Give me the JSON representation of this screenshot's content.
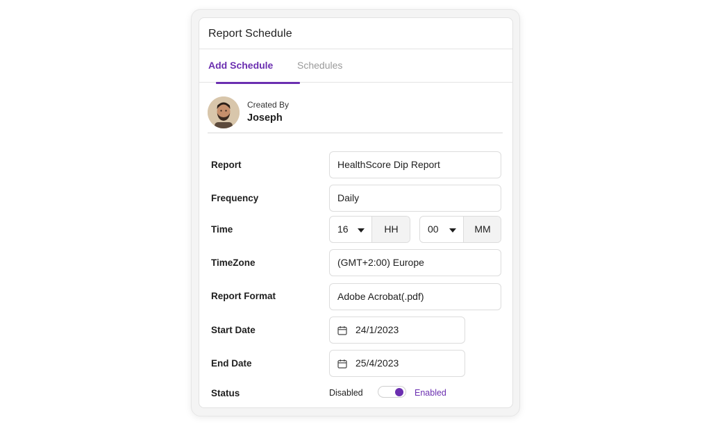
{
  "panel": {
    "title": "Report Schedule"
  },
  "tabs": [
    {
      "label": "Add Schedule",
      "active": true
    },
    {
      "label": "Schedules",
      "active": false
    }
  ],
  "creator": {
    "caption": "Created By",
    "name": "Joseph"
  },
  "form": {
    "report": {
      "label": "Report",
      "value": "HealthScore Dip Report"
    },
    "frequency": {
      "label": "Frequency",
      "value": "Daily"
    },
    "time": {
      "label": "Time",
      "hour": "16",
      "hour_unit": "HH",
      "minute": "00",
      "minute_unit": "MM"
    },
    "timezone": {
      "label": "TimeZone",
      "value": "(GMT+2:00) Europe"
    },
    "format": {
      "label": "Report Format",
      "value": "Adobe Acrobat(.pdf)"
    },
    "start_date": {
      "label": "Start Date",
      "value": "24/1/2023",
      "icon": "calendar-icon"
    },
    "end_date": {
      "label": "End Date",
      "value": "25/4/2023",
      "icon": "calendar-icon"
    },
    "status": {
      "label": "Status",
      "off_label": "Disabled",
      "on_label": "Enabled",
      "enabled": true
    }
  },
  "colors": {
    "accent": "#6b2fb0",
    "muted": "#9a9a9a",
    "border": "#dcdcdc"
  }
}
